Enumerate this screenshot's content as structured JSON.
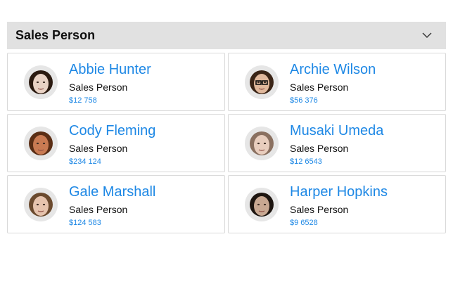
{
  "group": {
    "title": "Sales Person",
    "expand_icon": "chevron-down-icon"
  },
  "people": [
    {
      "name": "Abbie Hunter",
      "role": "Sales Person",
      "amount": "$12 758",
      "skin": "#e9d2c4",
      "hair": "#2b1a10"
    },
    {
      "name": "Archie Wilson",
      "role": "Sales Person",
      "amount": "$56 376",
      "skin": "#e0b89c",
      "hair": "#3a2416"
    },
    {
      "name": "Cody Fleming",
      "role": "Sales Person",
      "amount": "$234 124",
      "skin": "#c97a52",
      "hair": "#5a2d14"
    },
    {
      "name": "Musaki Umeda",
      "role": "Sales Person",
      "amount": "$12 6543",
      "skin": "#e8cdbd",
      "hair": "#8a7060"
    },
    {
      "name": "Gale Marshall",
      "role": "Sales Person",
      "amount": "$124 583",
      "skin": "#e6c3ad",
      "hair": "#6b4a2e"
    },
    {
      "name": "Harper Hopkins",
      "role": "Sales Person",
      "amount": "$9 6528",
      "skin": "#c8a892",
      "hair": "#1d1510"
    }
  ]
}
